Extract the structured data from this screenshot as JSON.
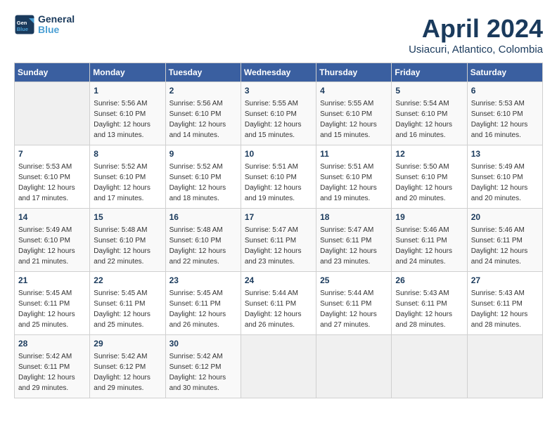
{
  "header": {
    "logo_general": "General",
    "logo_blue": "Blue",
    "month_title": "April 2024",
    "location": "Usiacuri, Atlantico, Colombia"
  },
  "days_of_week": [
    "Sunday",
    "Monday",
    "Tuesday",
    "Wednesday",
    "Thursday",
    "Friday",
    "Saturday"
  ],
  "weeks": [
    [
      {
        "num": "",
        "empty": true
      },
      {
        "num": "1",
        "sunrise": "5:56 AM",
        "sunset": "6:10 PM",
        "daylight": "12 hours and 13 minutes."
      },
      {
        "num": "2",
        "sunrise": "5:56 AM",
        "sunset": "6:10 PM",
        "daylight": "12 hours and 14 minutes."
      },
      {
        "num": "3",
        "sunrise": "5:55 AM",
        "sunset": "6:10 PM",
        "daylight": "12 hours and 15 minutes."
      },
      {
        "num": "4",
        "sunrise": "5:55 AM",
        "sunset": "6:10 PM",
        "daylight": "12 hours and 15 minutes."
      },
      {
        "num": "5",
        "sunrise": "5:54 AM",
        "sunset": "6:10 PM",
        "daylight": "12 hours and 16 minutes."
      },
      {
        "num": "6",
        "sunrise": "5:53 AM",
        "sunset": "6:10 PM",
        "daylight": "12 hours and 16 minutes."
      }
    ],
    [
      {
        "num": "7",
        "sunrise": "5:53 AM",
        "sunset": "6:10 PM",
        "daylight": "12 hours and 17 minutes."
      },
      {
        "num": "8",
        "sunrise": "5:52 AM",
        "sunset": "6:10 PM",
        "daylight": "12 hours and 17 minutes."
      },
      {
        "num": "9",
        "sunrise": "5:52 AM",
        "sunset": "6:10 PM",
        "daylight": "12 hours and 18 minutes."
      },
      {
        "num": "10",
        "sunrise": "5:51 AM",
        "sunset": "6:10 PM",
        "daylight": "12 hours and 19 minutes."
      },
      {
        "num": "11",
        "sunrise": "5:51 AM",
        "sunset": "6:10 PM",
        "daylight": "12 hours and 19 minutes."
      },
      {
        "num": "12",
        "sunrise": "5:50 AM",
        "sunset": "6:10 PM",
        "daylight": "12 hours and 20 minutes."
      },
      {
        "num": "13",
        "sunrise": "5:49 AM",
        "sunset": "6:10 PM",
        "daylight": "12 hours and 20 minutes."
      }
    ],
    [
      {
        "num": "14",
        "sunrise": "5:49 AM",
        "sunset": "6:10 PM",
        "daylight": "12 hours and 21 minutes."
      },
      {
        "num": "15",
        "sunrise": "5:48 AM",
        "sunset": "6:10 PM",
        "daylight": "12 hours and 22 minutes."
      },
      {
        "num": "16",
        "sunrise": "5:48 AM",
        "sunset": "6:10 PM",
        "daylight": "12 hours and 22 minutes."
      },
      {
        "num": "17",
        "sunrise": "5:47 AM",
        "sunset": "6:11 PM",
        "daylight": "12 hours and 23 minutes."
      },
      {
        "num": "18",
        "sunrise": "5:47 AM",
        "sunset": "6:11 PM",
        "daylight": "12 hours and 23 minutes."
      },
      {
        "num": "19",
        "sunrise": "5:46 AM",
        "sunset": "6:11 PM",
        "daylight": "12 hours and 24 minutes."
      },
      {
        "num": "20",
        "sunrise": "5:46 AM",
        "sunset": "6:11 PM",
        "daylight": "12 hours and 24 minutes."
      }
    ],
    [
      {
        "num": "21",
        "sunrise": "5:45 AM",
        "sunset": "6:11 PM",
        "daylight": "12 hours and 25 minutes."
      },
      {
        "num": "22",
        "sunrise": "5:45 AM",
        "sunset": "6:11 PM",
        "daylight": "12 hours and 25 minutes."
      },
      {
        "num": "23",
        "sunrise": "5:45 AM",
        "sunset": "6:11 PM",
        "daylight": "12 hours and 26 minutes."
      },
      {
        "num": "24",
        "sunrise": "5:44 AM",
        "sunset": "6:11 PM",
        "daylight": "12 hours and 26 minutes."
      },
      {
        "num": "25",
        "sunrise": "5:44 AM",
        "sunset": "6:11 PM",
        "daylight": "12 hours and 27 minutes."
      },
      {
        "num": "26",
        "sunrise": "5:43 AM",
        "sunset": "6:11 PM",
        "daylight": "12 hours and 28 minutes."
      },
      {
        "num": "27",
        "sunrise": "5:43 AM",
        "sunset": "6:11 PM",
        "daylight": "12 hours and 28 minutes."
      }
    ],
    [
      {
        "num": "28",
        "sunrise": "5:42 AM",
        "sunset": "6:11 PM",
        "daylight": "12 hours and 29 minutes."
      },
      {
        "num": "29",
        "sunrise": "5:42 AM",
        "sunset": "6:12 PM",
        "daylight": "12 hours and 29 minutes."
      },
      {
        "num": "30",
        "sunrise": "5:42 AM",
        "sunset": "6:12 PM",
        "daylight": "12 hours and 30 minutes."
      },
      {
        "num": "",
        "empty": true
      },
      {
        "num": "",
        "empty": true
      },
      {
        "num": "",
        "empty": true
      },
      {
        "num": "",
        "empty": true
      }
    ]
  ]
}
